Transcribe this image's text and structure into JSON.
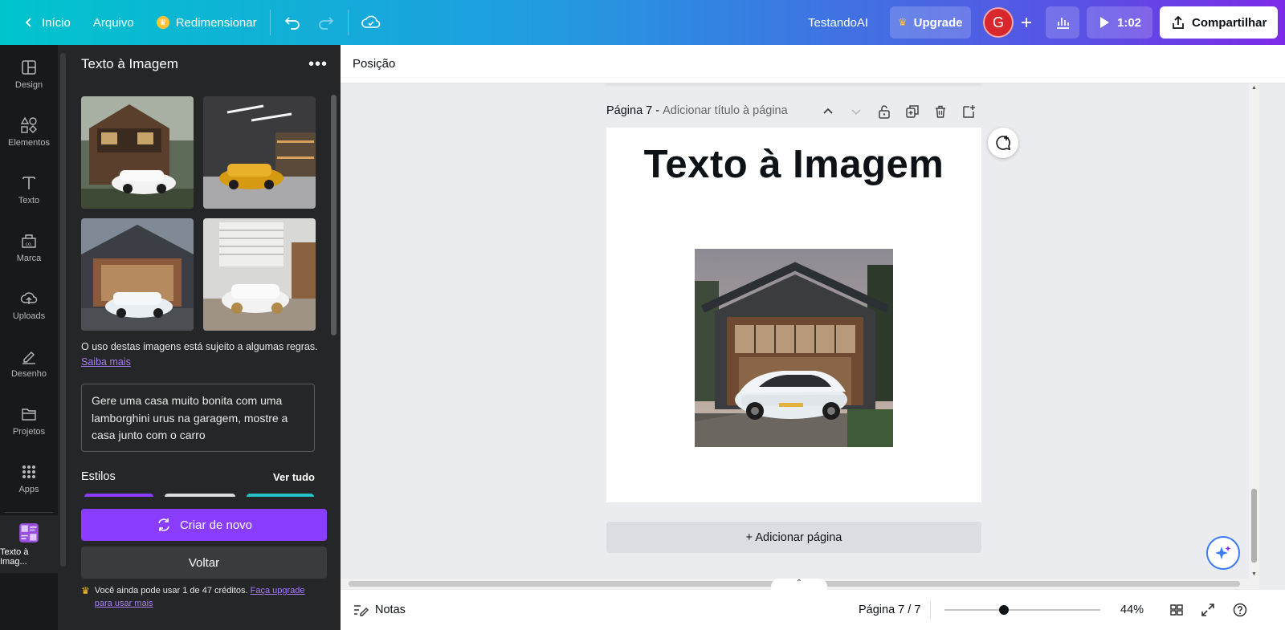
{
  "topbar": {
    "home": "Início",
    "file": "Arquivo",
    "resize": "Redimensionar",
    "doc_title": "TestandoAI",
    "upgrade": "Upgrade",
    "avatar_letter": "G",
    "timer": "1:02",
    "share": "Compartilhar"
  },
  "rail": {
    "items": [
      {
        "label": "Design",
        "icon": "layout-icon"
      },
      {
        "label": "Elementos",
        "icon": "shapes-icon"
      },
      {
        "label": "Texto",
        "icon": "text-icon"
      },
      {
        "label": "Marca",
        "icon": "brand-icon"
      },
      {
        "label": "Uploads",
        "icon": "cloud-upload-icon"
      },
      {
        "label": "Desenho",
        "icon": "pen-icon"
      },
      {
        "label": "Projetos",
        "icon": "folder-icon"
      },
      {
        "label": "Apps",
        "icon": "grid-icon"
      },
      {
        "label": "Texto à Imag...",
        "icon": "text-to-image-icon"
      }
    ]
  },
  "panel": {
    "title": "Texto à Imagem",
    "note": "O uso destas imagens está sujeito a algumas regras.",
    "note_link": "Saiba mais",
    "prompt": "Gere uma casa muito bonita com uma lamborghini urus na garagem, mostre a casa junto com o carro",
    "styles_label": "Estilos",
    "see_all": "Ver tudo",
    "create_again": "Criar de novo",
    "back": "Voltar",
    "credits_text": "Você ainda pode usar 1 de 47 créditos.",
    "credits_link": "Faça upgrade para usar mais"
  },
  "editor": {
    "position": "Posição",
    "page_number": "Página 7 -",
    "page_title_placeholder": "Adicionar título à página",
    "page_heading": "Texto à Imagem",
    "add_page": "+ Adicionar página"
  },
  "footer": {
    "notes": "Notas",
    "pager": "Página 7 / 7",
    "zoom": "44%",
    "zoom_level": 0.38
  },
  "colors": {
    "accent": "#8b3dff",
    "brand_gradient_start": "#00c4cc",
    "brand_gradient_end": "#7d2ae8"
  }
}
